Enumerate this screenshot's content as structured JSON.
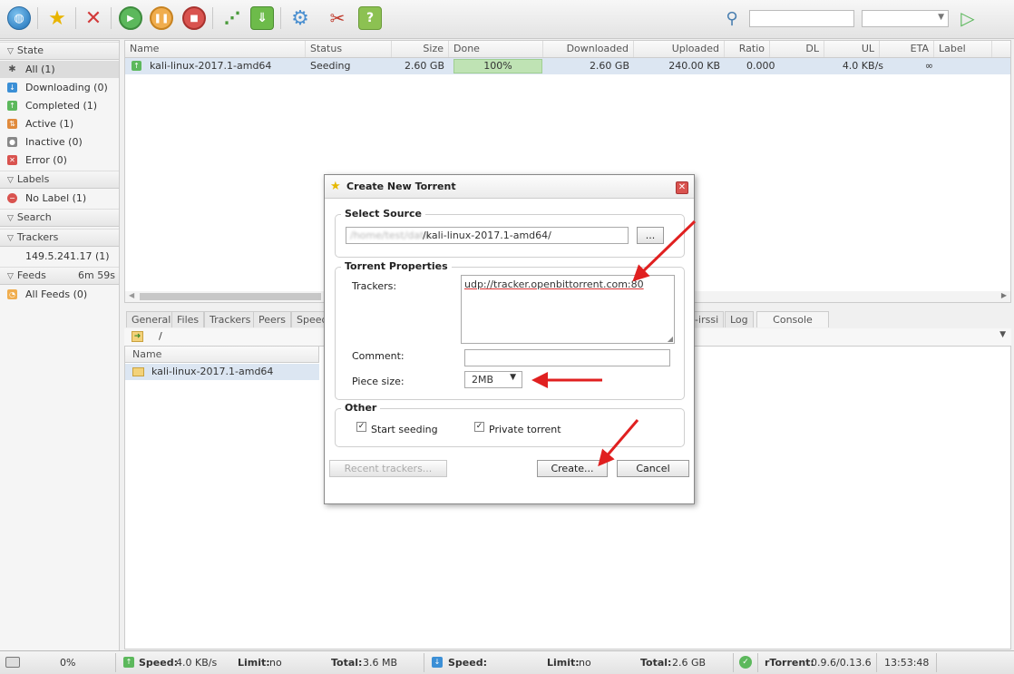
{
  "toolbar": {
    "icons": [
      "globe-icon",
      "star-icon",
      "remove-icon",
      "start-icon",
      "pause-icon",
      "stop-icon",
      "rss-icon",
      "download-icon",
      "settings-icon",
      "tools-icon",
      "help-icon",
      "search-icon",
      "go-icon"
    ],
    "search_value": "",
    "search_select_value": ""
  },
  "sidebar": {
    "state_title": "State",
    "state_items": [
      {
        "label": "All (1)"
      },
      {
        "label": "Downloading (0)"
      },
      {
        "label": "Completed (1)"
      },
      {
        "label": "Active (1)"
      },
      {
        "label": "Inactive (0)"
      },
      {
        "label": "Error (0)"
      }
    ],
    "labels_title": "Labels",
    "labels_items": [
      {
        "label": "No Label (1)"
      }
    ],
    "search_title": "Search",
    "trackers_title": "Trackers",
    "trackers_items": [
      {
        "label": "149.5.241.17 (1)"
      }
    ],
    "feeds_title": "Feeds",
    "feeds_timer": "6m 59s",
    "feeds_items": [
      {
        "label": "All Feeds (0)"
      }
    ]
  },
  "list": {
    "columns": [
      "Name",
      "Status",
      "Size",
      "Done",
      "Downloaded",
      "Uploaded",
      "Ratio",
      "DL",
      "UL",
      "ETA",
      "Label"
    ],
    "rows": [
      {
        "name": "kali-linux-2017.1-amd64",
        "status": "Seeding",
        "size": "2.60 GB",
        "done": "100%",
        "done_fraction": 1.0,
        "downloaded": "2.60 GB",
        "uploaded": "240.00 KB",
        "ratio": "0.000",
        "dl": "",
        "ul": "4.0 KB/s",
        "eta": "∞",
        "label": ""
      }
    ]
  },
  "details": {
    "tabs": [
      "General",
      "Files",
      "Trackers",
      "Peers",
      "Speed",
      "l-irssi",
      "Log",
      "Console"
    ],
    "path": "/",
    "name_header": "Name",
    "file_row": "kali-linux-2017.1-amd64"
  },
  "dialog": {
    "title": "Create New Torrent",
    "select_source_legend": "Select Source",
    "source_prefix": "/home/test/data",
    "source_value": "/kali-linux-2017.1-amd64/",
    "browse_label": "...",
    "props_legend": "Torrent Properties",
    "trackers_label": "Trackers:",
    "trackers_value": "udp://tracker.openbittorrent.com:80",
    "comment_label": "Comment:",
    "comment_value": "",
    "piece_label": "Piece size:",
    "piece_value": "2MB",
    "other_legend": "Other",
    "start_seeding_label": "Start seeding",
    "start_seeding_checked": true,
    "private_label": "Private torrent",
    "private_checked": true,
    "recent_trackers_label": "Recent trackers...",
    "create_label": "Create...",
    "cancel_label": "Cancel"
  },
  "statusbar": {
    "disk_pct": "0%",
    "ul_speed_label": "Speed:",
    "ul_speed_value": "4.0 KB/s",
    "ul_limit_label": "Limit:",
    "ul_limit_value": "no",
    "ul_total_label": "Total:",
    "ul_total_value": "3.6 MB",
    "dl_speed_label": "Speed:",
    "dl_speed_value": "",
    "dl_limit_label": "Limit:",
    "dl_limit_value": "no",
    "dl_total_label": "Total:",
    "dl_total_value": "2.6 GB",
    "client_label": "rTorrent:",
    "client_version": "0.9.6/0.13.6",
    "clock": "13:53:48"
  },
  "colors": {
    "accent_red": "#e02020",
    "progress_green": "#bfe3b4",
    "selection_blue": "#dce6f2"
  }
}
